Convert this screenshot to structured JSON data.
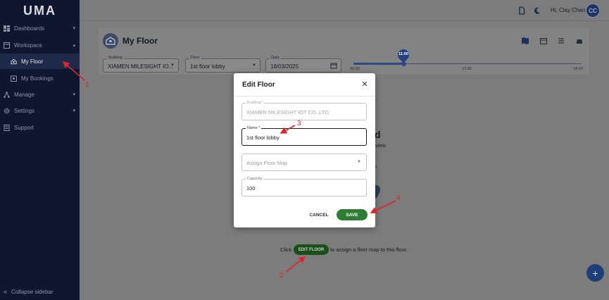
{
  "app": {
    "logo": "UMA"
  },
  "sidebar": {
    "items": [
      {
        "label": "Dashboards",
        "icon": "dashboard-icon"
      },
      {
        "label": "Workspace",
        "icon": "workspace-icon"
      },
      {
        "label": "My Floor",
        "icon": "floor-icon"
      },
      {
        "label": "My Bookings",
        "icon": "bookings-icon"
      },
      {
        "label": "Manage",
        "icon": "manage-icon"
      },
      {
        "label": "Settings",
        "icon": "gear-icon"
      },
      {
        "label": "Support",
        "icon": "support-icon"
      }
    ],
    "collapse_label": "Collapse sidebar"
  },
  "header": {
    "greeting": "Hi, Clay Chen",
    "avatar_initials": "CC"
  },
  "page": {
    "title": "My Floor",
    "filters": {
      "building_label": "Building",
      "building_value": "XIAMEN MILESIGHT IO...",
      "floor_label": "Floor",
      "floor_value": "1st floor lobby",
      "date_label": "Date",
      "date_value": "18/03/2025"
    },
    "timeline": {
      "current": "11:00",
      "start": "09:00",
      "mid": "13:30",
      "end": "18:00"
    },
    "bg_fragments": {
      "d": "d",
      "view": "view"
    },
    "hint_prefix": "Click",
    "edit_floor_label": "EDIT FLOOR",
    "hint_suffix": "to assign a floor map to this floor.",
    "fab": "+"
  },
  "dialog": {
    "title": "Edit Floor",
    "building_label": "Building*",
    "building_value": "XIAMEN MILESIGHT IOT CO.,LTD.",
    "name_label": "Name *",
    "name_value": "1st floor lobby",
    "floor_map_placeholder": "Assign Floor Map",
    "capacity_label": "Capacity",
    "capacity_value": "100",
    "cancel_label": "CANCEL",
    "save_label": "SAVE"
  },
  "annotations": {
    "a1": "1",
    "a2": "2",
    "a3": "3",
    "a4": "4"
  },
  "colors": {
    "sidebar_bg": "#0e1630",
    "save_green": "#2e7d32",
    "accent_blue": "#1e3e7a",
    "annotation_red": "#e0242b"
  }
}
